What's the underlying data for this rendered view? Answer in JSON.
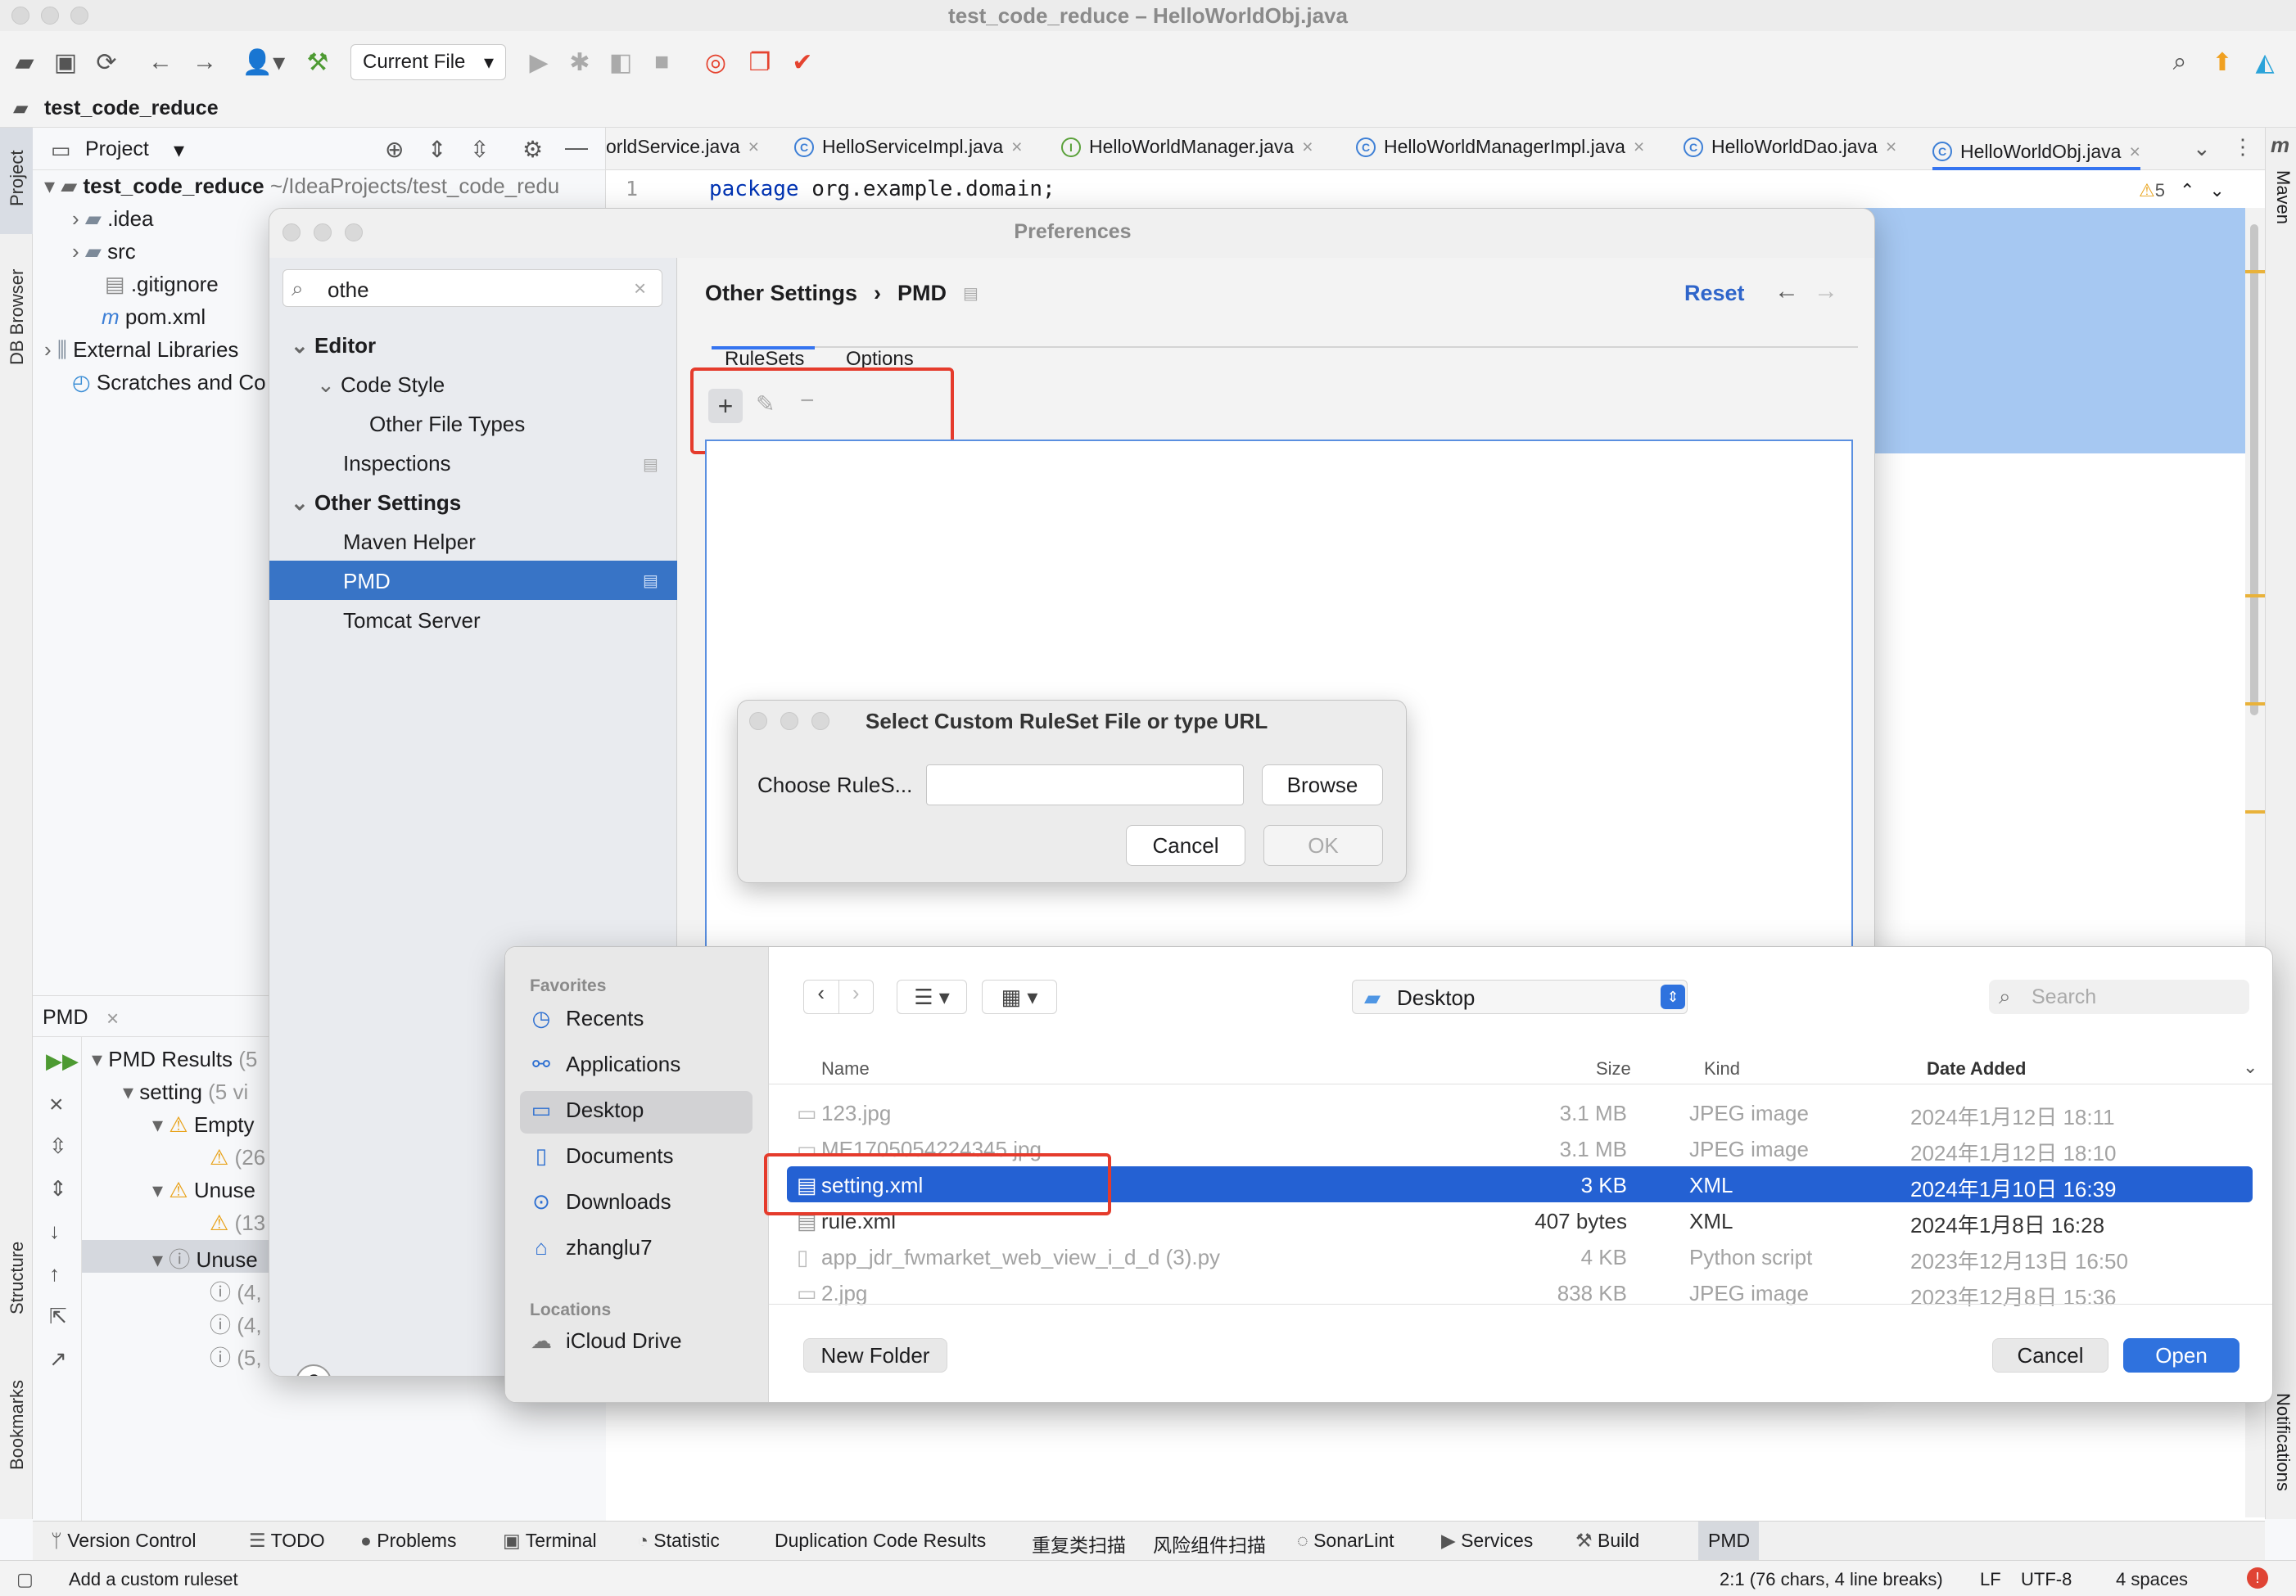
{
  "window": {
    "title": "test_code_reduce – HelloWorldObj.java"
  },
  "toolbar": {
    "run_config": "Current File"
  },
  "breadcrumb": {
    "project": "test_code_reduce"
  },
  "side_strip": {
    "project": "Project",
    "db_browser": "DB Browser",
    "structure": "Structure",
    "bookmarks": "Bookmarks",
    "maven": "Maven",
    "notifications": "Notifications"
  },
  "project_panel": {
    "title": "Project",
    "root_name": "test_code_reduce",
    "root_path": "~/IdeaProjects/test_code_redu",
    "items": [
      ".idea",
      "src",
      ".gitignore",
      "pom.xml"
    ],
    "external_libraries": "External Libraries",
    "scratches": "Scratches and Co"
  },
  "editor": {
    "tabs": [
      "orldService.java",
      "HelloServiceImpl.java",
      "HelloWorldManager.java",
      "HelloWorldManagerImpl.java",
      "HelloWorldDao.java",
      "HelloWorldObj.java"
    ],
    "tab_icons": [
      "",
      "C",
      "I",
      "C",
      "C",
      "C"
    ],
    "line_number": "1",
    "code_keyword": "package",
    "code_rest": "org.example.domain;",
    "warning_count": "5"
  },
  "preferences": {
    "title": "Preferences",
    "search_value": "othe",
    "tree": {
      "editor": "Editor",
      "code_style": "Code Style",
      "other_file_types": "Other File Types",
      "inspections": "Inspections",
      "other_settings": "Other Settings",
      "maven_helper": "Maven Helper",
      "pmd": "PMD",
      "tomcat": "Tomcat Server"
    },
    "breadcrumb_parent": "Other Settings",
    "breadcrumb_sep": "›",
    "breadcrumb_current": "PMD",
    "reset": "Reset",
    "tabs": [
      "RuleSets",
      "Options"
    ],
    "help": "?"
  },
  "ruleset_dialog": {
    "title": "Select Custom RuleSet File or type URL",
    "label": "Choose RuleS...",
    "input_value": "",
    "browse": "Browse",
    "cancel": "Cancel",
    "ok": "OK"
  },
  "file_dialog": {
    "favorites_header": "Favorites",
    "favorites": [
      {
        "icon": "clock-icon",
        "label": "Recents"
      },
      {
        "icon": "applications-icon",
        "label": "Applications"
      },
      {
        "icon": "desktop-icon",
        "label": "Desktop"
      },
      {
        "icon": "document-icon",
        "label": "Documents"
      },
      {
        "icon": "download-icon",
        "label": "Downloads"
      },
      {
        "icon": "home-icon",
        "label": "zhanglu7"
      }
    ],
    "locations_header": "Locations",
    "locations": [
      {
        "icon": "cloud-icon",
        "label": "iCloud Drive"
      }
    ],
    "location": "Desktop",
    "search_placeholder": "Search",
    "columns": {
      "name": "Name",
      "size": "Size",
      "kind": "Kind",
      "date": "Date Added"
    },
    "files": [
      {
        "name": "123.jpg",
        "size": "3.1 MB",
        "kind": "JPEG image",
        "date": "2024年1月12日 18:11"
      },
      {
        "name": "ME1705054224345.jpg",
        "size": "3.1 MB",
        "kind": "JPEG image",
        "date": "2024年1月12日 18:10"
      },
      {
        "name": "setting.xml",
        "size": "3 KB",
        "kind": "XML",
        "date": "2024年1月10日 16:39"
      },
      {
        "name": "rule.xml",
        "size": "407 bytes",
        "kind": "XML",
        "date": "2024年1月8日 16:28"
      },
      {
        "name": "app_jdr_fwmarket_web_view_i_d_d (3).py",
        "size": "4 KB",
        "kind": "Python script",
        "date": "2023年12月13日 16:50"
      },
      {
        "name": "2.jpg",
        "size": "838 KB",
        "kind": "JPEG image",
        "date": "2023年12月8日 15:36"
      }
    ],
    "new_folder": "New Folder",
    "cancel": "Cancel",
    "open": "Open"
  },
  "pmd_panel": {
    "title": "PMD",
    "results": "PMD Results",
    "results_suffix": "(5",
    "setting": "setting",
    "setting_suffix": "(5 vi",
    "empty": "Empty",
    "unused1": "Unuse",
    "unused2": "Unuse",
    "counts": [
      "(26",
      "(13",
      "(4,",
      "(4,",
      "(5,"
    ]
  },
  "bottom_tabs": [
    "Version Control",
    "TODO",
    "Problems",
    "Terminal",
    "Statistic",
    "Duplication Code Results",
    "重复类扫描",
    "风险组件扫描",
    "SonarLint",
    "Services",
    "Build",
    "PMD"
  ],
  "status": {
    "message": "Add a custom ruleset",
    "position": "2:1 (76 chars, 4 line breaks)",
    "line_sep": "LF",
    "encoding": "UTF-8",
    "indent": "4 spaces"
  },
  "colors": {
    "accent": "#2461d3",
    "selection": "#3874c6",
    "highlight": "#e53b2c",
    "keyword": "#0033b3"
  }
}
